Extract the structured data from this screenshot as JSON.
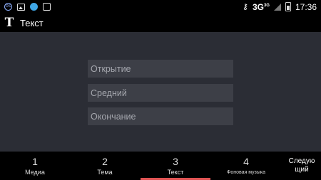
{
  "status_bar": {
    "left_icons": [
      "data-saver-icon",
      "image-icon",
      "bird-app-icon",
      "game-app-icon"
    ],
    "network": "3G",
    "network_sup": "3G",
    "time": "17:36"
  },
  "app_bar": {
    "icon": "text-icon",
    "icon_glyph": "T",
    "title": "Текст"
  },
  "form": {
    "opening_placeholder": "Открытие",
    "middle_placeholder": "Средний",
    "ending_placeholder": "Окончание"
  },
  "bottom_nav": {
    "tabs": [
      {
        "number": "1",
        "label": "Медиа"
      },
      {
        "number": "2",
        "label": "Тема"
      },
      {
        "number": "3",
        "label": "Текст"
      },
      {
        "number": "4",
        "label": "Фоновая музыка"
      }
    ],
    "active_tab": "3",
    "next_label_line1": "Следую",
    "next_label_line2": "щий"
  },
  "colors": {
    "background": "#2b2d35",
    "field_bg": "#3d3f47",
    "active_indicator": "#e05353"
  }
}
